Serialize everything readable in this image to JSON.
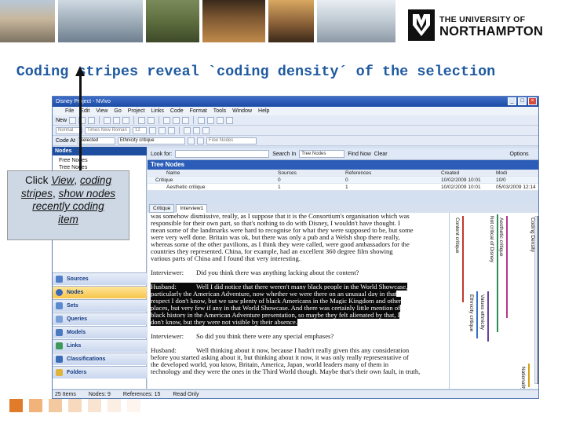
{
  "banner": {
    "logo_line1": "THE UNIVERSITY OF",
    "logo_line2": "NORTHAMPTON"
  },
  "heading": "Coding stripes reveal `coding density´ of the selection",
  "window": {
    "title": "Disney Project - NVivo",
    "menu": [
      "File",
      "Edit",
      "View",
      "Go",
      "Project",
      "Links",
      "Code",
      "Format",
      "Tools",
      "Window",
      "Help"
    ],
    "toolbar": {
      "new_label": "New",
      "style_select": "Normal",
      "font_select": "Times New Roman",
      "size_select": "12",
      "code_at_label": "Code At",
      "code_at_select": "Selected",
      "code_node_select": "Ethnicity critique",
      "free_nodes_select": "Free Nodes"
    },
    "left_panel": {
      "title": "Nodes",
      "tree_items": [
        "Free Nodes",
        "Tree Nodes"
      ],
      "nav_buttons": [
        "Sources",
        "Nodes",
        "Sets",
        "Queries",
        "Models",
        "Links",
        "Classifications",
        "Folders"
      ]
    },
    "find_bar": {
      "look_for_label": "Look for:",
      "search_in_label": "Search In",
      "search_in_value": "Tree Nodes",
      "find_now": "Find Now",
      "clear": "Clear",
      "options": "Options"
    },
    "tree_nodes": {
      "title": "Tree Nodes",
      "columns": [
        "Name",
        "Sources",
        "References",
        "Created",
        "Modi"
      ],
      "rows": [
        {
          "name": "Critique",
          "sources": "0",
          "references": "0",
          "created": "10/02/2009 10:01",
          "modified": "10/0"
        },
        {
          "name": "Aesthetic critique",
          "sources": "1",
          "references": "1",
          "created": "10/02/2009 10:01",
          "modified": "05/03/2009 12:14"
        }
      ]
    },
    "doc_tabs": [
      "Critique",
      "Interview1"
    ],
    "document_lines": [
      {
        "speaker": "",
        "text": "was somehow dismissive, really, as I suppose that it is the Consortium's organisation which was",
        "hl": false
      },
      {
        "speaker": "",
        "text": "responsible for their own part, so that's nothing to do with Disney, I wouldn't have thought. I",
        "hl": false
      },
      {
        "speaker": "",
        "text": "mean some of the landmarks were hard to recognise for what they were supposed to be, but some",
        "hl": false
      },
      {
        "speaker": "",
        "text": "were very well done. Britain was ok, but there was only a pub and a Welsh shop there really,",
        "hl": false
      },
      {
        "speaker": "",
        "text": "whereas some of the other pavilions, as I think they were called, were good ambassadors for the",
        "hl": false
      },
      {
        "speaker": "",
        "text": "countries they represented. China, for example, had an excellent 360 degree film showing",
        "hl": false
      },
      {
        "speaker": "",
        "text": "various parts of China and I found that very interesting.",
        "hl": false
      },
      {
        "speaker": "",
        "text": "",
        "hl": false
      },
      {
        "speaker": "Interviewer:",
        "text": "Did you think there was anything lacking about the content?",
        "hl": false
      },
      {
        "speaker": "",
        "text": "",
        "hl": false
      },
      {
        "speaker": "Husband:",
        "text": "Well I did notice that there weren't many black people in the World Showcase,",
        "hl": true
      },
      {
        "speaker": "",
        "text": "particularly the American Adventure, now whether we were there on an unusual day in that",
        "hl": true
      },
      {
        "speaker": "",
        "text": "respect I don't know, but we saw plenty of black Americans in the Magic Kingdom and other",
        "hl": true
      },
      {
        "speaker": "",
        "text": "places, but very few if any in that World Showcase. And there was certainly little mention of",
        "hl": true
      },
      {
        "speaker": "",
        "text": "black history in the American Adventure presentation, so maybe they felt alienated by that, I",
        "hl": true
      },
      {
        "speaker": "",
        "text": "don't know, but they were not visible by their absence.",
        "hl": true
      },
      {
        "speaker": "",
        "text": "",
        "hl": false
      },
      {
        "speaker": "Interviewer:",
        "text": "So did you think there were any special emphases?",
        "hl": false
      },
      {
        "speaker": "",
        "text": "",
        "hl": false
      },
      {
        "speaker": "Husband:",
        "text": "Well thinking about it now, because I hadn't really given this any consideration",
        "hl": false
      },
      {
        "speaker": "",
        "text": "before you started asking about it, but thinking about it now, it was only really representative of",
        "hl": false
      },
      {
        "speaker": "",
        "text": "the developed world, you know, Britain, America, Japan, world leaders many of them in",
        "hl": false
      },
      {
        "speaker": "",
        "text": "technology and they were the ones in the Third World though. Maybe that's their own fault, in truth,",
        "hl": false
      }
    ],
    "coding_stripes": [
      {
        "label": "Content critique",
        "color": "#c0392b"
      },
      {
        "label": "Not critical of Disney",
        "color": "#2e8b57"
      },
      {
        "label": "Aesthetic critique",
        "color": "#b03a8c"
      },
      {
        "label": "Ethnicity critique",
        "color": "#3a6fc4"
      },
      {
        "label": "Values ethnicity",
        "color": "#6a3fa0"
      },
      {
        "label": "Nationality critique",
        "color": "#d4a017"
      },
      {
        "label": "Coding Density",
        "color": "#444444"
      }
    ],
    "status_bar": [
      "25 Items",
      "Nodes: 9",
      "References: 15",
      "Read Only"
    ]
  },
  "callout": {
    "line1": "Click ",
    "view": "View",
    "sep1": ", ",
    "coding": "coding",
    "stripes": "stripes",
    "sep2": ", ",
    "show_nodes": "show nodes",
    "recently": "recently coding",
    "item": "item"
  },
  "colors": {
    "heading": "#1f5aa0",
    "window_title": "#1c4ba6",
    "callout_bg": "#cdd8e4",
    "squares": [
      "#e07b2a",
      "#f2b37a",
      "#f3c9a0",
      "#f7d9bd",
      "#f9e4d1",
      "#fbeee2",
      "#fdf5ee"
    ]
  }
}
